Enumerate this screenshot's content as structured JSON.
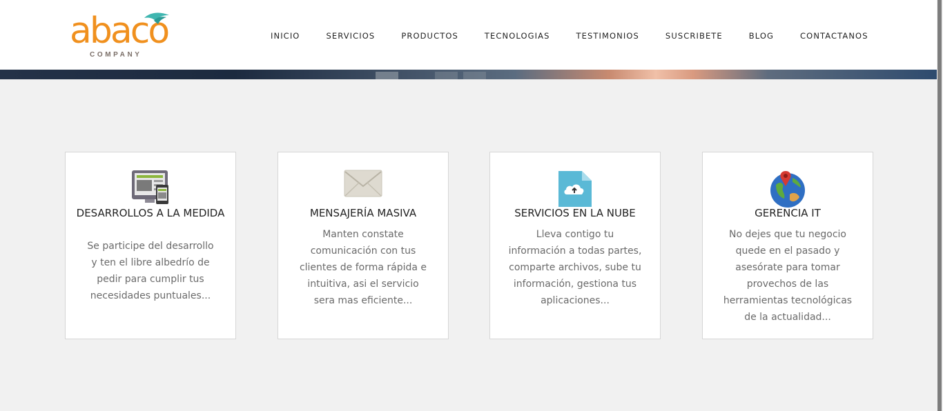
{
  "logo": {
    "word": "abaco",
    "sub": "COMPANY"
  },
  "nav": [
    "INICIO",
    "SERVICIOS",
    "PRODUCTOS",
    "TECNOLOGIAS",
    "TESTIMONIOS",
    "SUSCRIBETE",
    "BLOG",
    "CONTACTANOS"
  ],
  "cards": [
    {
      "title": "DESARROLLOS A LA MEDIDA",
      "text": "Se participe del desarrollo y ten el libre albedrío de pedir para cumplir tus necesidades puntuales...",
      "icon": "web-mobile-icon"
    },
    {
      "title": "MENSAJERÍA MASIVA",
      "text": "Manten constate comunicación con tus clientes de forma rápida e intuitiva, asi el servicio sera mas eficiente...",
      "icon": "envelope-icon"
    },
    {
      "title": "SERVICIOS EN LA NUBE",
      "text": "Lleva contigo tu información a todas partes, comparte archivos, sube tu información, gestiona tus aplicaciones...",
      "icon": "cloud-upload-file-icon"
    },
    {
      "title": "GERENCIA IT",
      "text": "No dejes que tu negocio quede en el pasado y asesórate para tomar provechos de las herramientas tecnológicas de la actualidad...",
      "icon": "globe-pin-icon"
    }
  ],
  "colors": {
    "brand_orange": "#f0901e",
    "brand_teal": "#3fb6b0",
    "page_bg": "#f1f1f1"
  }
}
